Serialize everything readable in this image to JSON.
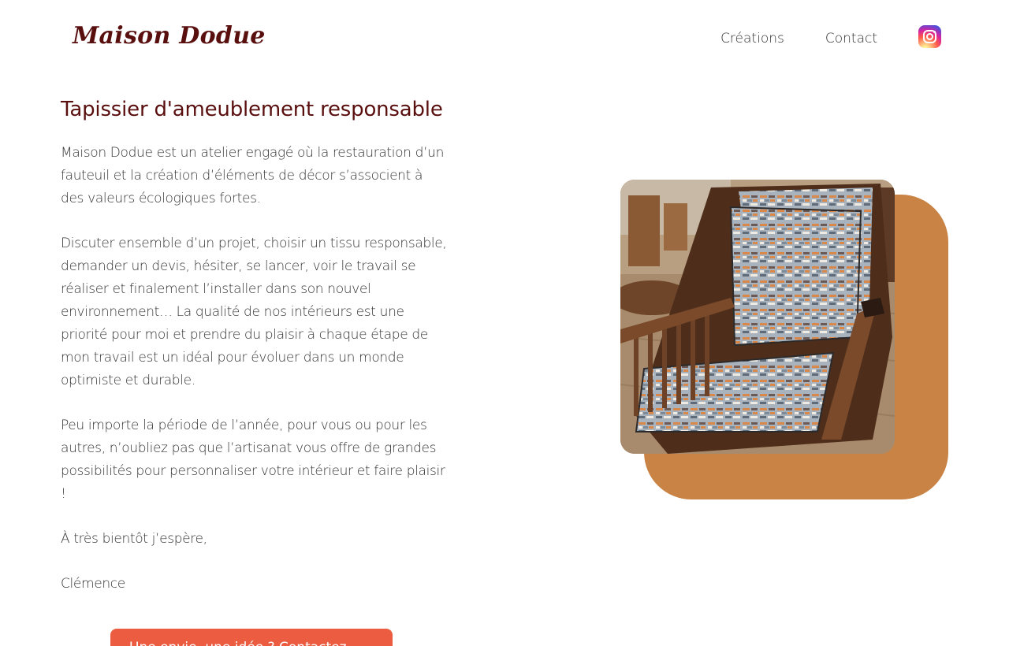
{
  "header": {
    "logo": "Maison Dodue",
    "nav": [
      {
        "label": "Créations"
      },
      {
        "label": "Contact"
      }
    ],
    "instagram_icon": "instagram-icon"
  },
  "main": {
    "heading": "Tapissier d'ameublement responsable",
    "paragraphs": [
      "Maison Dodue est un atelier engagé où la restauration d’un fauteuil et la création d’éléments de décor s’associent à des valeurs écologiques fortes.",
      "Discuter ensemble d’un projet, choisir un tissu responsable, demander un devis, hésiter, se lancer, voir le travail se réaliser et finalement l’installer dans son nouvel environnement… La qualité de nos intérieurs est une priorité pour moi et prendre du plaisir à chaque étape de mon travail est un idéal pour évoluer dans un monde optimiste et durable.",
      "Peu importe la période de l’année, pour vous ou pour les autres, n’oubliez pas que l’artisanat vous offre de grandes possibilités pour personnaliser votre intérieur et faire plaisir !",
      "À très bientôt j’espère,",
      "Clémence"
    ],
    "cta_label": "Une envie, une idée ? Contactez-moi !"
  },
  "colors": {
    "brand": "#5a0f0f",
    "accent_backdrop": "#c98345",
    "cta": "#ec5c40"
  }
}
